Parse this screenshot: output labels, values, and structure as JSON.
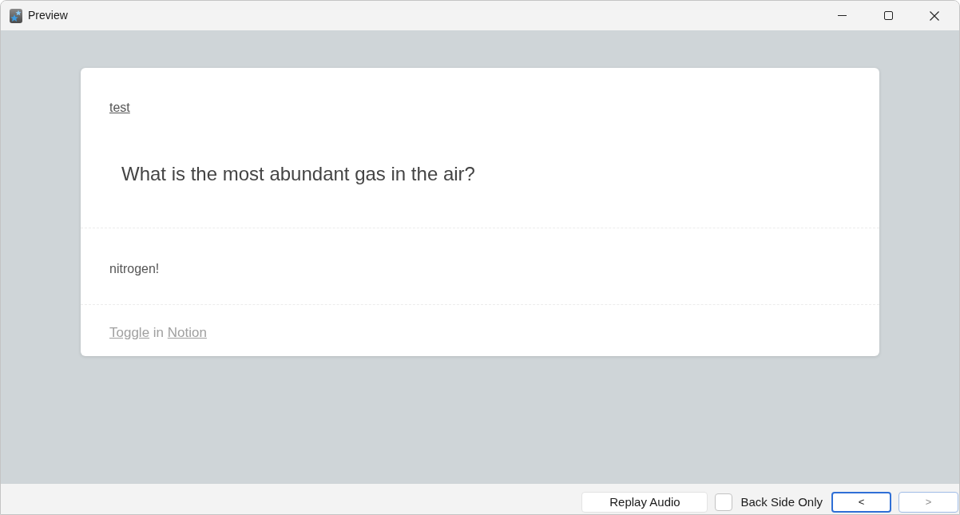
{
  "window": {
    "title": "Preview"
  },
  "card": {
    "deck_link": "test",
    "question": "What is the most abundant gas in the air?",
    "answer": "nitrogen!",
    "footer": {
      "link": "Toggle",
      "text": "in",
      "source_link": "Notion"
    }
  },
  "bottom_bar": {
    "replay_button": "Replay Audio",
    "back_side_only": {
      "label": "Back Side Only",
      "checked": false
    },
    "nav_buttons": [
      {
        "label": "<",
        "focused": true,
        "disabled": false
      },
      {
        "label": ">",
        "focused": false,
        "disabled": true
      }
    ]
  }
}
